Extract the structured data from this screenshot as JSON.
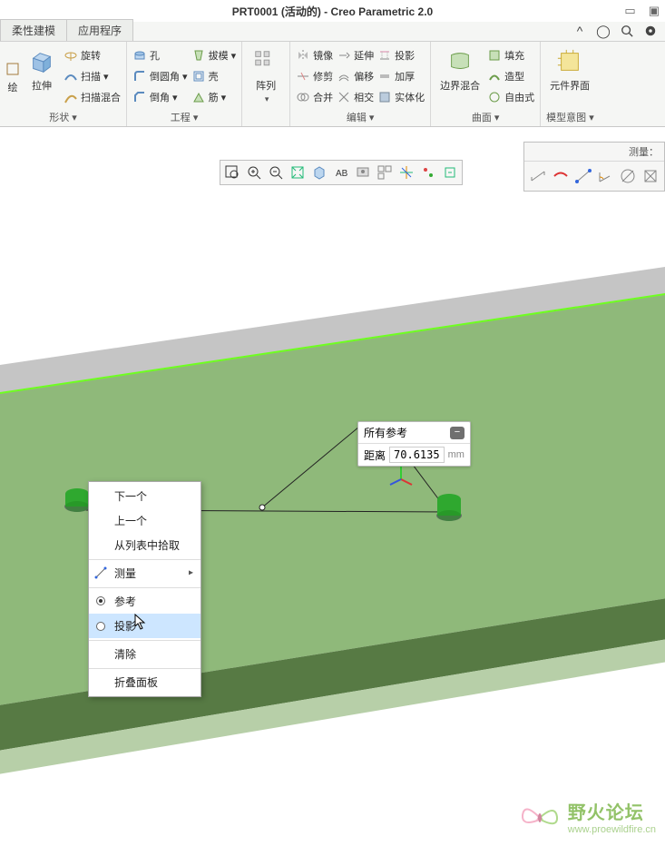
{
  "title": "PRT0001 (活动的) - Creo Parametric 2.0",
  "tabs": [
    "柔性建模",
    "应用程序"
  ],
  "ribbon": {
    "groups": [
      {
        "label": "形状 ▾",
        "big": [
          {
            "label": "拉伸"
          }
        ],
        "rows": [
          [
            "旋转"
          ],
          [
            "扫描 ▾"
          ],
          [
            "扫描混合"
          ]
        ]
      },
      {
        "label": "工程 ▾",
        "rows1": [
          [
            "孔"
          ],
          [
            "倒圆角 ▾"
          ],
          [
            "倒角 ▾"
          ]
        ],
        "rows2": [
          [
            "拔模 ▾"
          ],
          [
            "壳"
          ],
          [
            "筋 ▾"
          ]
        ]
      },
      {
        "label": "阵列 ▾",
        "big": [
          {
            "label": "阵列"
          }
        ]
      },
      {
        "label": "编辑 ▾",
        "rows1": [
          [
            "镜像"
          ],
          [
            "修剪"
          ],
          [
            "合并"
          ]
        ],
        "rows2": [
          [
            "延伸"
          ],
          [
            "偏移"
          ],
          [
            "相交"
          ]
        ],
        "rows3": [
          [
            "投影"
          ],
          [
            "加厚"
          ],
          [
            "实体化"
          ]
        ]
      },
      {
        "label": "曲面 ▾",
        "big": [
          {
            "label": "边界混合"
          }
        ],
        "rows": [
          [
            "填充"
          ],
          [
            "造型"
          ],
          [
            "自由式"
          ]
        ]
      },
      {
        "label": "模型意图 ▾",
        "big": [
          {
            "label": "元件界面"
          }
        ]
      }
    ]
  },
  "measure_panel_title": "测量：",
  "info": {
    "head": "所有参考",
    "label": "距离",
    "value": "70.6135",
    "unit": "mm"
  },
  "context_menu": {
    "items": [
      {
        "label": "下一个"
      },
      {
        "label": "上一个"
      },
      {
        "label": "从列表中拾取"
      },
      {
        "label": "测量",
        "icon": true,
        "submenu": true,
        "sep": true
      },
      {
        "label": "参考",
        "radio": true,
        "checked": true,
        "sep": true
      },
      {
        "label": "投影",
        "radio": true,
        "checked": false,
        "hl": true
      },
      {
        "label": "清除",
        "sep": true
      },
      {
        "label": "折叠面板",
        "sep": true
      }
    ]
  },
  "watermark": {
    "cn": "野火论坛",
    "url": "www.proewildfire.cn"
  }
}
